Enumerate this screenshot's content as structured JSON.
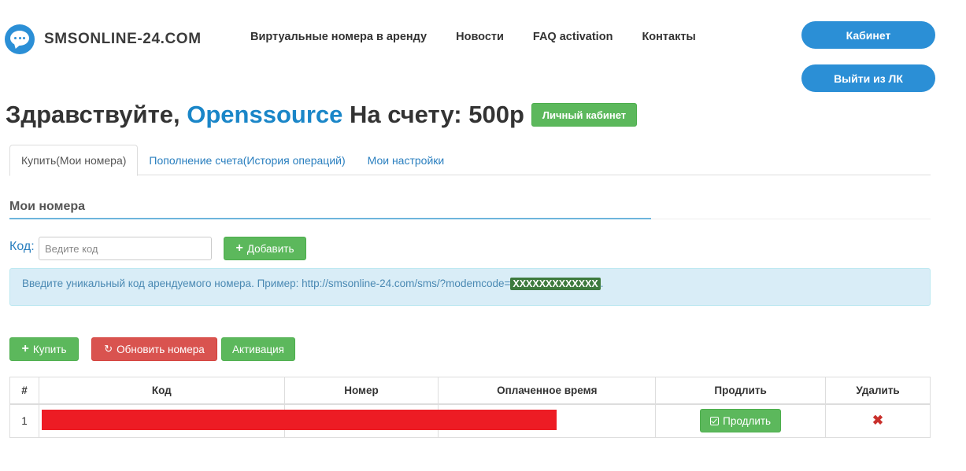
{
  "header": {
    "logo_text": "SMSONLINE-24.COM",
    "nav": [
      "Виртуальные номера в аренду",
      "Новости",
      "FAQ activation",
      "Контакты"
    ],
    "cabinet_button": "Кабинет",
    "logout_button": "Выйти из ЛК"
  },
  "greeting": {
    "hello": "Здравствуйте,",
    "username": "Openssource",
    "balance_label": "На счету: 500р",
    "lk_button": "Личный кабинет"
  },
  "tabs": [
    "Купить(Мои номера)",
    "Пополнение счета(История операций)",
    "Мои настройки"
  ],
  "section": {
    "title": "Мои номера",
    "code_label": "Код:",
    "code_placeholder": "Ведите код",
    "add_button": "Добавить",
    "info_text": "Введите уникальный код арендуемого номера. Пример: http://smsonline-24.com/sms/?modemcode=",
    "info_code": "XXXXXXXXXXXXX",
    "info_suffix": "."
  },
  "actions": {
    "buy_button": "Купить",
    "refresh_button": "Обновить номера",
    "activation_button": "Активация"
  },
  "table": {
    "columns": [
      "#",
      "Код",
      "Номер",
      "Оплаченное время",
      "Продлить",
      "Удалить"
    ],
    "rows": [
      {
        "num": "1",
        "extend_button": "Продлить"
      }
    ]
  },
  "colors": {
    "accent_blue": "#2b8fd6",
    "green": "#5cb85c",
    "red": "#d9534f",
    "redaction": "#ed1c24"
  },
  "icons": [
    "chat-bubble-icon",
    "plus-icon",
    "refresh-icon",
    "check-square-icon",
    "delete-x-icon"
  ]
}
